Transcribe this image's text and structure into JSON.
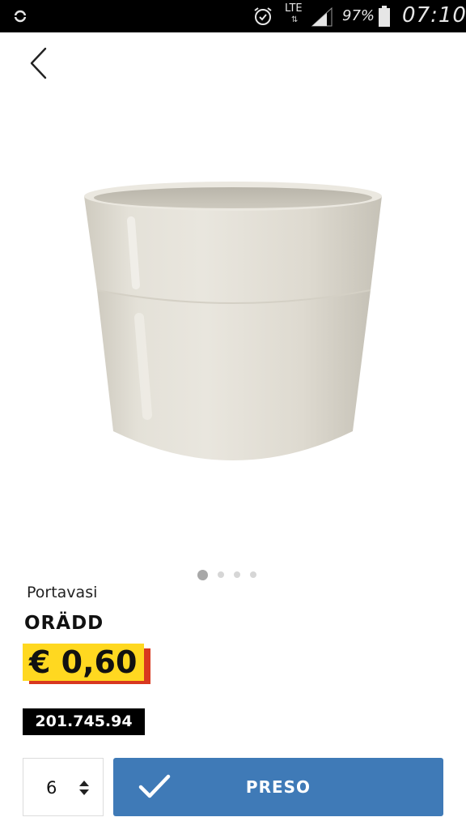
{
  "status_bar": {
    "network": "LTE",
    "battery_percent": "97%",
    "time": "07:10",
    "icons": [
      "sync-icon",
      "alarm-icon",
      "signal-icon",
      "battery-icon"
    ]
  },
  "navigation": {
    "back_icon": "chevron-left-icon"
  },
  "product": {
    "image": "beige ceramic plant pot",
    "category": "Portavasi",
    "name": "ORÄDD",
    "price": "€ 0,60",
    "article_number": "201.745.94",
    "gallery": {
      "count": 4,
      "active_index": 0
    }
  },
  "actions": {
    "quantity": "6",
    "quantity_icon": "stepper-arrows-icon",
    "preso_label": "PRESO",
    "preso_icon": "checkmark-icon"
  },
  "colors": {
    "price_tag": "#ffd820",
    "price_tag_shadow": "#d8381f",
    "button": "#3f7ab7"
  }
}
